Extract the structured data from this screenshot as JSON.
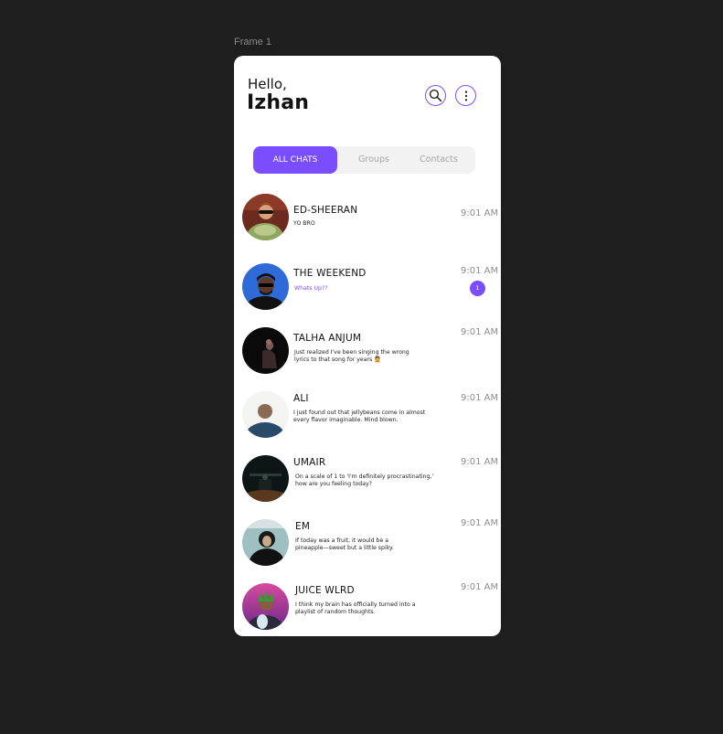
{
  "frame_label": "Frame 1",
  "header": {
    "greeting": "Hello,",
    "user_name": "Izhan"
  },
  "tabs": [
    {
      "label": "ALL CHATS",
      "active": true
    },
    {
      "label": "Groups",
      "active": false
    },
    {
      "label": "Contacts",
      "active": false
    }
  ],
  "chats": [
    {
      "name": "ED-SHEERAN",
      "message": "YO BRO",
      "time": "9:01 AM",
      "unread": false
    },
    {
      "name": "THE WEEKEND",
      "message": "Whats Up??",
      "time": "9:01 AM",
      "unread": true,
      "unread_count": "1"
    },
    {
      "name": "TALHA ANJUM",
      "message": "Just realized I've been singing the wrong lyrics to that song for years 🤦",
      "time": "9:01 AM",
      "unread": false
    },
    {
      "name": "ALI",
      "message": "I just found out that jellybeans come in almost every flavor imaginable. Mind blown.",
      "time": "9:01 AM",
      "unread": false
    },
    {
      "name": "UMAIR",
      "message": "On a scale of 1 to 'I'm definitely procrastinating,' how are you feeling today?",
      "time": "9:01 AM",
      "unread": false
    },
    {
      "name": "EM",
      "message": "If today was a fruit, it would be a pineapple—sweet but a little spiky.",
      "time": "9:01 AM",
      "unread": false
    },
    {
      "name": "JUICE WLRD",
      "message": "I think my brain has officially turned into a playlist of random thoughts.",
      "time": "9:01 AM",
      "unread": false
    }
  ],
  "colors": {
    "accent": "#7a4dff",
    "background": "#1e1e1e",
    "card": "#ffffff"
  },
  "icons": {
    "search": "search-icon",
    "more": "more-vertical-icon"
  }
}
